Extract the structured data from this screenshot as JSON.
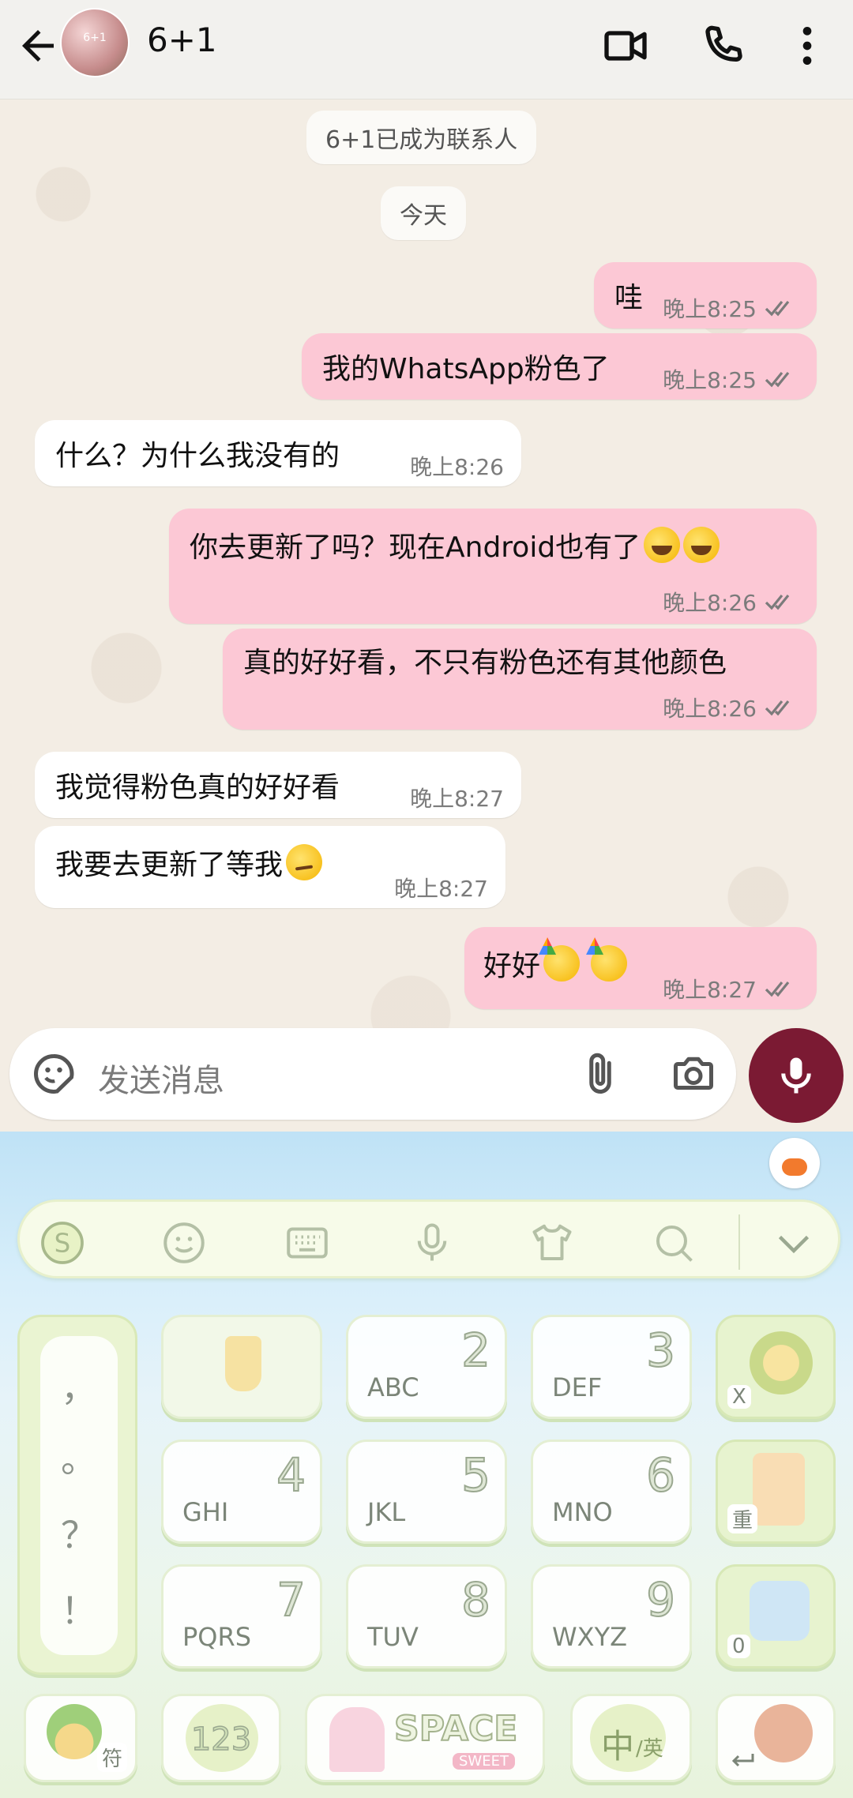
{
  "header": {
    "title": "6+1",
    "avatar_text": "6+1"
  },
  "chat": {
    "system": [
      "6+1已成为联系人",
      "今天"
    ],
    "messages": [
      {
        "dir": "out",
        "text": "哇",
        "time": "晚上8:25"
      },
      {
        "dir": "out",
        "text": "我的WhatsApp粉色了",
        "time": "晚上8:25"
      },
      {
        "dir": "in",
        "text": "什么？为什么我没有的",
        "time": "晚上8:26"
      },
      {
        "dir": "out",
        "text": "你去更新了吗？现在Android也有了",
        "time": "晚上8:26"
      },
      {
        "dir": "out",
        "text": "真的好好看，不只有粉色还有其他颜色",
        "time": "晚上8:26"
      },
      {
        "dir": "in",
        "text": "我觉得粉色真的好好看",
        "time": "晚上8:27"
      },
      {
        "dir": "in",
        "text": "我要去更新了等我",
        "time": "晚上8:27"
      },
      {
        "dir": "out",
        "text": "好好",
        "time": "晚上8:27"
      }
    ]
  },
  "input": {
    "placeholder": "发送消息"
  },
  "keyboard": {
    "symbols": [
      "，",
      "。",
      "？",
      "！"
    ],
    "keys": [
      {
        "num": "2",
        "letters": "ABC"
      },
      {
        "num": "3",
        "letters": "DEF"
      },
      {
        "num": "4",
        "letters": "GHI"
      },
      {
        "num": "5",
        "letters": "JKL"
      },
      {
        "num": "6",
        "letters": "MNO"
      },
      {
        "num": "7",
        "letters": "PQRS"
      },
      {
        "num": "8",
        "letters": "TUV"
      },
      {
        "num": "9",
        "letters": "WXYZ"
      }
    ],
    "delete_label": "X",
    "retype_label": "重",
    "zero_label": "0",
    "bottom": {
      "symbols_label": "符",
      "num_label": "123",
      "space_label": "SPACE",
      "space_sub": "SWEET",
      "lang_main": "中",
      "lang_sub": "/英"
    }
  },
  "colors": {
    "out_bubble": "#fcc8d5",
    "in_bubble": "#ffffff",
    "mic": "#7b1a33",
    "chat_bg": "#f3ede4"
  },
  "icons": [
    "back-arrow-icon",
    "video-call-icon",
    "voice-call-icon",
    "more-vert-icon",
    "sticker-icon",
    "attach-icon",
    "camera-icon",
    "mic-icon",
    "double-check-icon"
  ]
}
